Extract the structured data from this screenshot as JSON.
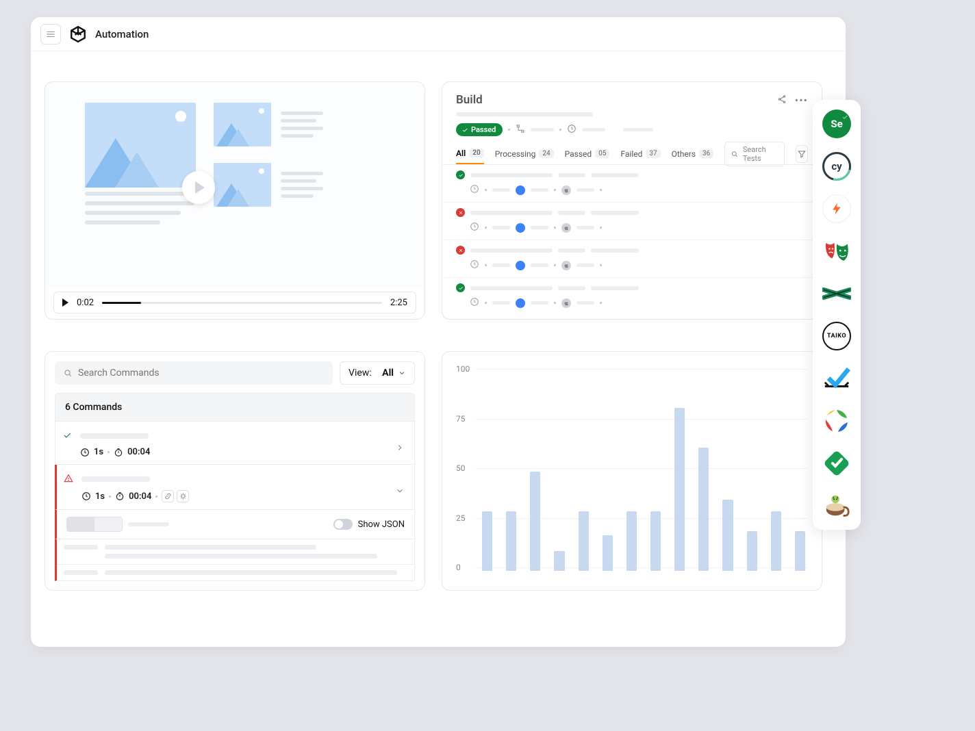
{
  "header": {
    "title": "Automation"
  },
  "video": {
    "current": "0:02",
    "total": "2:25"
  },
  "build": {
    "title": "Build",
    "status": "Passed",
    "tabs": [
      {
        "label": "All",
        "count": "20"
      },
      {
        "label": "Processing",
        "count": "24"
      },
      {
        "label": "Passed",
        "count": "05"
      },
      {
        "label": "Failed",
        "count": "37"
      },
      {
        "label": "Others",
        "count": "36"
      }
    ],
    "search_placeholder": "Search Tests",
    "rows": [
      {
        "status": "ok"
      },
      {
        "status": "err"
      },
      {
        "status": "err"
      },
      {
        "status": "ok"
      }
    ]
  },
  "commands": {
    "search_placeholder": "Search Commands",
    "view_label": "View:",
    "view_value": "All",
    "header": "6 Commands",
    "row1": {
      "dur": "1s",
      "time": "00:04"
    },
    "row2": {
      "dur": "1s",
      "time": "00:04"
    },
    "show_json_label": "Show JSON"
  },
  "chart_data": {
    "type": "bar",
    "values": [
      30,
      30,
      50,
      10,
      30,
      18,
      30,
      30,
      82,
      62,
      36,
      20,
      30,
      20
    ],
    "ylim": [
      0,
      100
    ],
    "yticks": [
      0,
      25,
      50,
      75,
      100
    ],
    "title": "",
    "xlabel": "",
    "ylabel": ""
  },
  "tools": [
    {
      "name": "selenium"
    },
    {
      "name": "cypress"
    },
    {
      "name": "lightning"
    },
    {
      "name": "playwright"
    },
    {
      "name": "xframework"
    },
    {
      "name": "taiko"
    },
    {
      "name": "checkmark"
    },
    {
      "name": "appium"
    },
    {
      "name": "katalon"
    },
    {
      "name": "espresso"
    }
  ]
}
